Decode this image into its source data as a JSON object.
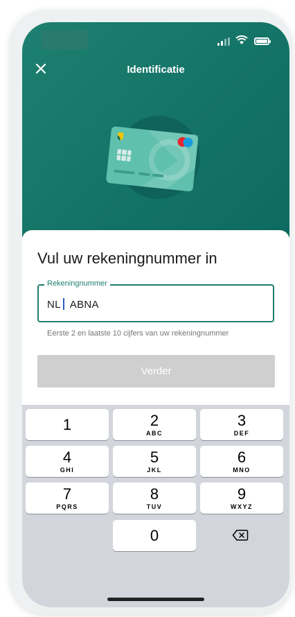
{
  "header": {
    "title": "Identificatie",
    "close_icon": "close-icon"
  },
  "status_bar": {
    "icons": [
      "signal-icon",
      "wifi-icon",
      "battery-icon"
    ]
  },
  "main": {
    "heading": "Vul uw rekeningnummer in",
    "field": {
      "label": "Rekeningnummer",
      "prefix": "NL",
      "bank": "ABNA"
    },
    "hint": "Eerste 2 en laatste 10 cijfers van uw rekeningnummer",
    "next_label": "Verder"
  },
  "keyboard": {
    "keys": [
      {
        "num": "1",
        "letters": ""
      },
      {
        "num": "2",
        "letters": "ABC"
      },
      {
        "num": "3",
        "letters": "DEF"
      },
      {
        "num": "4",
        "letters": "GHI"
      },
      {
        "num": "5",
        "letters": "JKL"
      },
      {
        "num": "6",
        "letters": "MNO"
      },
      {
        "num": "7",
        "letters": "PQRS"
      },
      {
        "num": "8",
        "letters": "TUV"
      },
      {
        "num": "9",
        "letters": "WXYZ"
      },
      {
        "num": "0",
        "letters": ""
      }
    ],
    "backspace_icon": "backspace-icon"
  },
  "colors": {
    "header_green": "#137266",
    "accent": "#1e7e6f",
    "button_disabled": "#cfcfcf",
    "keyboard_bg": "#d2d5db"
  }
}
